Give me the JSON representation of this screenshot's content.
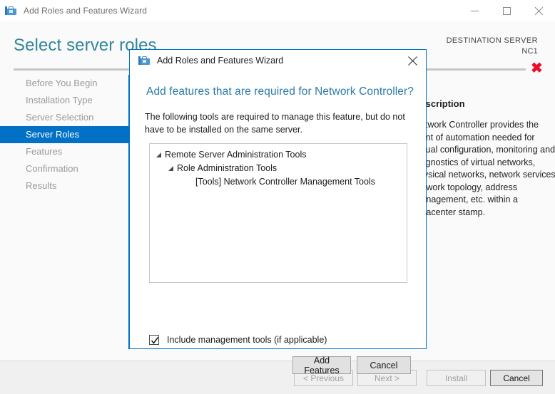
{
  "window": {
    "title": "Add Roles and Features Wizard",
    "icon": "wizard-toolbox-icon",
    "controls": {
      "minimize": "minimize-icon",
      "maximize": "maximize-icon",
      "close": "close-icon"
    }
  },
  "page": {
    "title": "Select server roles",
    "destination_label": "DESTINATION SERVER",
    "destination_server": "NC1",
    "alert_icon": "error-x-icon"
  },
  "sidebar": {
    "items": [
      {
        "label": "Before You Begin",
        "active": false
      },
      {
        "label": "Installation Type",
        "active": false
      },
      {
        "label": "Server Selection",
        "active": false
      },
      {
        "label": "Server Roles",
        "active": true
      },
      {
        "label": "Features",
        "active": false
      },
      {
        "label": "Confirmation",
        "active": false
      },
      {
        "label": "Results",
        "active": false
      }
    ]
  },
  "description_panel": {
    "title": "Description",
    "body": "Network Controller provides the point of automation needed for virtual configuration, monitoring and diagnostics of virtual networks, physical networks, network services, network topology, address management, etc. within a datacenter stamp."
  },
  "footer": {
    "previous": "< Previous",
    "next": "Next >",
    "install": "Install",
    "cancel": "Cancel"
  },
  "dialog": {
    "title": "Add Roles and Features Wizard",
    "icon": "wizard-toolbox-icon",
    "close_icon": "close-icon",
    "heading": "Add features that are required for Network Controller?",
    "subtext": "The following tools are required to manage this feature, but do not have to be installed on the same server.",
    "tree": [
      {
        "label": "Remote Server Administration Tools",
        "level": 1,
        "expander": "expanded-triangle-icon"
      },
      {
        "label": "Role Administration Tools",
        "level": 2,
        "expander": "expanded-triangle-icon"
      },
      {
        "label": "[Tools] Network Controller Management Tools",
        "level": 3,
        "expander": ""
      }
    ],
    "checkbox": {
      "label": "Include management tools (if applicable)",
      "checked": true
    },
    "buttons": {
      "add_features": "Add Features",
      "cancel": "Cancel"
    }
  },
  "colors": {
    "accent_blue": "#0071c5",
    "heading_teal": "#31859b",
    "dialog_heading_blue": "#2a7ba8",
    "alert_red": "#e8112d",
    "nav_inactive": "#9a9a9a"
  }
}
